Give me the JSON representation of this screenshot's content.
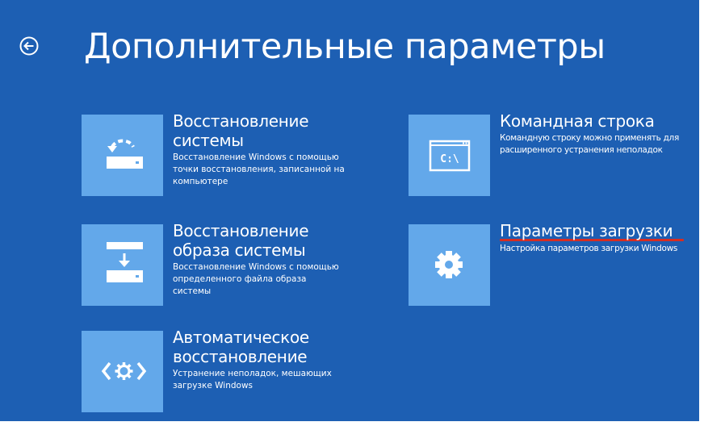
{
  "header": {
    "back_icon": "back-arrow-icon",
    "title": "Дополнительные параметры"
  },
  "options": [
    {
      "icon": "system-restore-icon",
      "title_line1": "Восстановление",
      "title_line2": "системы",
      "description": "Восстановление Windows с помощью точки восстановления, записанной на компьютере"
    },
    {
      "icon": "system-image-recovery-icon",
      "title_line1": "Восстановление",
      "title_line2": "образа системы",
      "description": "Восстановление Windows с помощью определенного файла образа системы"
    },
    {
      "icon": "automatic-repair-icon",
      "title_line1": "Автоматическое",
      "title_line2": "восстановление",
      "description": "Устранение неполадок, мешающих загрузке Windows"
    },
    {
      "icon": "command-prompt-icon",
      "icon_text": "C:\\",
      "title": "Командная строка",
      "description": "Командную строку можно применять для расширенного устранения неполадок"
    },
    {
      "icon": "gear-icon",
      "title": "Параметры загрузки",
      "description": "Настройка параметров загрузки Windows",
      "highlight_color": "#d62d22"
    }
  ],
  "colors": {
    "background": "#1d5fb3",
    "tile": "#63a8ea",
    "text": "#ffffff",
    "highlight": "#d62d22"
  }
}
